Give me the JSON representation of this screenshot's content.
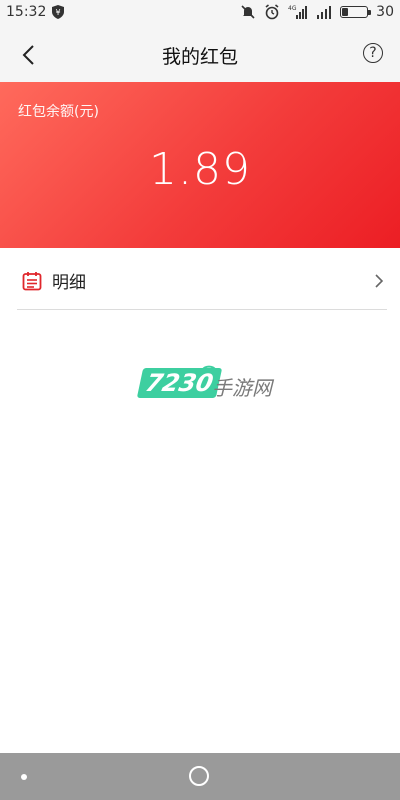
{
  "status_bar": {
    "time": "15:32",
    "network": "4G",
    "battery": "30"
  },
  "header": {
    "title": "我的红包",
    "help_symbol": "?"
  },
  "balance": {
    "label": "红包余额(元)",
    "amount": "1.89"
  },
  "detail": {
    "label": "明细"
  },
  "watermark": {
    "number": "7230",
    "text": "手游网"
  },
  "icons": {
    "back": "back-arrow-icon",
    "help": "question-circle-icon",
    "calendar": "calendar-icon",
    "chevron": "chevron-right-icon"
  },
  "colors": {
    "accent_red": "#ec1e24",
    "accent_red_light": "#ff6a5c",
    "header_bg": "#f5f5f5",
    "navbar_bg": "#9a9a9a"
  }
}
